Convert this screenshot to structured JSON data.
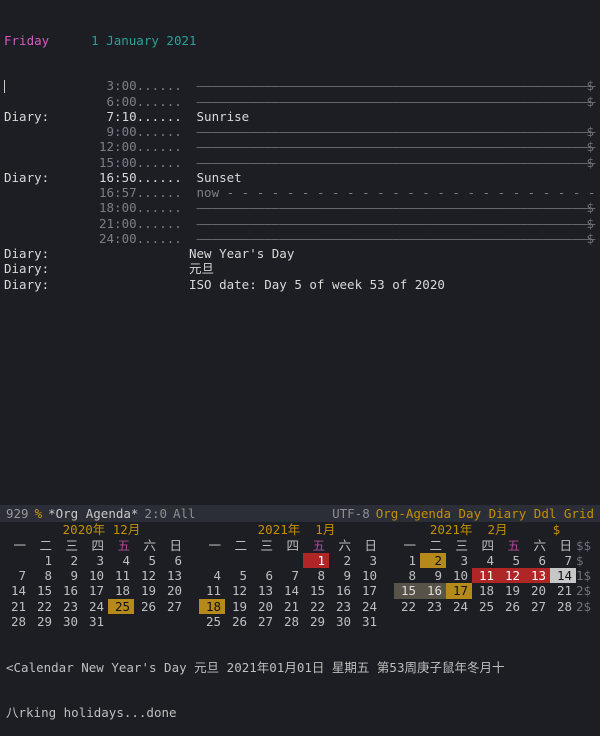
{
  "agenda": {
    "day_label": "Friday",
    "date_label": "1 January 2021",
    "rows": [
      {
        "source": "",
        "time": " 3:00",
        "dots": "......",
        "body_type": "dash"
      },
      {
        "source": "",
        "time": " 6:00",
        "dots": "......",
        "body_type": "dash"
      },
      {
        "source": "Diary:",
        "time": " 7:10",
        "dots": "......",
        "body": "Sunrise",
        "body_type": "text-hl"
      },
      {
        "source": "",
        "time": " 9:00",
        "dots": "......",
        "body_type": "dash"
      },
      {
        "source": "",
        "time": "12:00",
        "dots": "......",
        "body_type": "dash"
      },
      {
        "source": "",
        "time": "15:00",
        "dots": "......",
        "body_type": "dash"
      },
      {
        "source": "Diary:",
        "time": "16:50",
        "dots": "......",
        "body": "Sunset",
        "body_type": "text-hl"
      },
      {
        "source": "",
        "time": "16:57",
        "dots": "......",
        "body": "now - - - - - - - - - - - - - - - - - - - - - - - - -",
        "body_type": "now"
      },
      {
        "source": "",
        "time": "18:00",
        "dots": "......",
        "body_type": "dash"
      },
      {
        "source": "",
        "time": "21:00",
        "dots": "......",
        "body_type": "dash"
      },
      {
        "source": "",
        "time": "24:00",
        "dots": "......",
        "body_type": "dash"
      },
      {
        "source": "Diary:",
        "time": "",
        "dots": "",
        "body": "New Year's Day",
        "body_type": "text-hl-noend"
      },
      {
        "source": "Diary:",
        "time": "",
        "dots": "",
        "body": "元旦",
        "body_type": "text-hl-noend"
      },
      {
        "source": "Diary:",
        "time": "",
        "dots": "",
        "body": "ISO date: Day 5 of week 53 of 2020",
        "body_type": "text-hl-noend"
      }
    ],
    "dash_fill": "—————————————————————————————————————————————————————"
  },
  "modeline": {
    "line": "929",
    "pct": "%",
    "buffer": "*Org Agenda*",
    "pos": "2:0",
    "all": "All",
    "enc": "UTF-8",
    "modes": "Org-Agenda Day Diary Ddl Grid"
  },
  "calendars": [
    {
      "title": "2020年 12月",
      "head": [
        "一",
        "二",
        "三",
        "四",
        "五",
        "六",
        "日"
      ],
      "weeks": [
        [
          " ",
          "1",
          "2",
          "3",
          "4",
          "5",
          "6"
        ],
        [
          "7",
          "8",
          "9",
          "10",
          "11",
          "12",
          "13"
        ],
        [
          "14",
          "15",
          "16",
          "17",
          "18",
          "19",
          "20"
        ],
        [
          "21",
          "22",
          "23",
          "24",
          "25",
          "26",
          "27"
        ],
        [
          "28",
          "29",
          "30",
          "31",
          " ",
          " ",
          " "
        ]
      ],
      "marks": {
        "25": "amber"
      },
      "trail": ""
    },
    {
      "title": "2021年  1月",
      "head": [
        "一",
        "二",
        "三",
        "四",
        "五",
        "六",
        "日"
      ],
      "weeks": [
        [
          " ",
          " ",
          " ",
          " ",
          "1",
          "2",
          "3"
        ],
        [
          "4",
          "5",
          "6",
          "7",
          "8",
          "9",
          "10"
        ],
        [
          "11",
          "12",
          "13",
          "14",
          "15",
          "16",
          "17"
        ],
        [
          "18",
          "19",
          "20",
          "21",
          "22",
          "23",
          "24"
        ],
        [
          "25",
          "26",
          "27",
          "28",
          "29",
          "30",
          "31"
        ]
      ],
      "marks": {
        "1": "red",
        "18": "amber"
      },
      "trail": ""
    },
    {
      "title": "2021年  2月",
      "head": [
        "一",
        "二",
        "三",
        "四",
        "五",
        "六",
        "日"
      ],
      "weeks": [
        [
          "1",
          "2",
          "3",
          "4",
          "5",
          "6",
          "7"
        ],
        [
          "8",
          "9",
          "10",
          "11",
          "12",
          "13",
          "14"
        ],
        [
          "15",
          "16",
          "17",
          "18",
          "19",
          "20",
          "21"
        ],
        [
          "22",
          "23",
          "24",
          "25",
          "26",
          "27",
          "28"
        ],
        [
          " ",
          " ",
          " ",
          " ",
          " ",
          " ",
          " "
        ]
      ],
      "marks": {
        "2": "amber",
        "11": "red",
        "12": "red",
        "13": "red",
        "14": "today",
        "15": "pale",
        "16": "pale",
        "17": "amber"
      },
      "trail": "$",
      "row_trail": [
        "$$",
        "$",
        "1$",
        "2$",
        "2$",
        ""
      ]
    }
  ],
  "status": {
    "line1": "<Calendar New Year's Day 元旦 2021年01月01日 星期五 第53周庚子鼠年冬月十",
    "line2": "八rking holidays...done"
  }
}
